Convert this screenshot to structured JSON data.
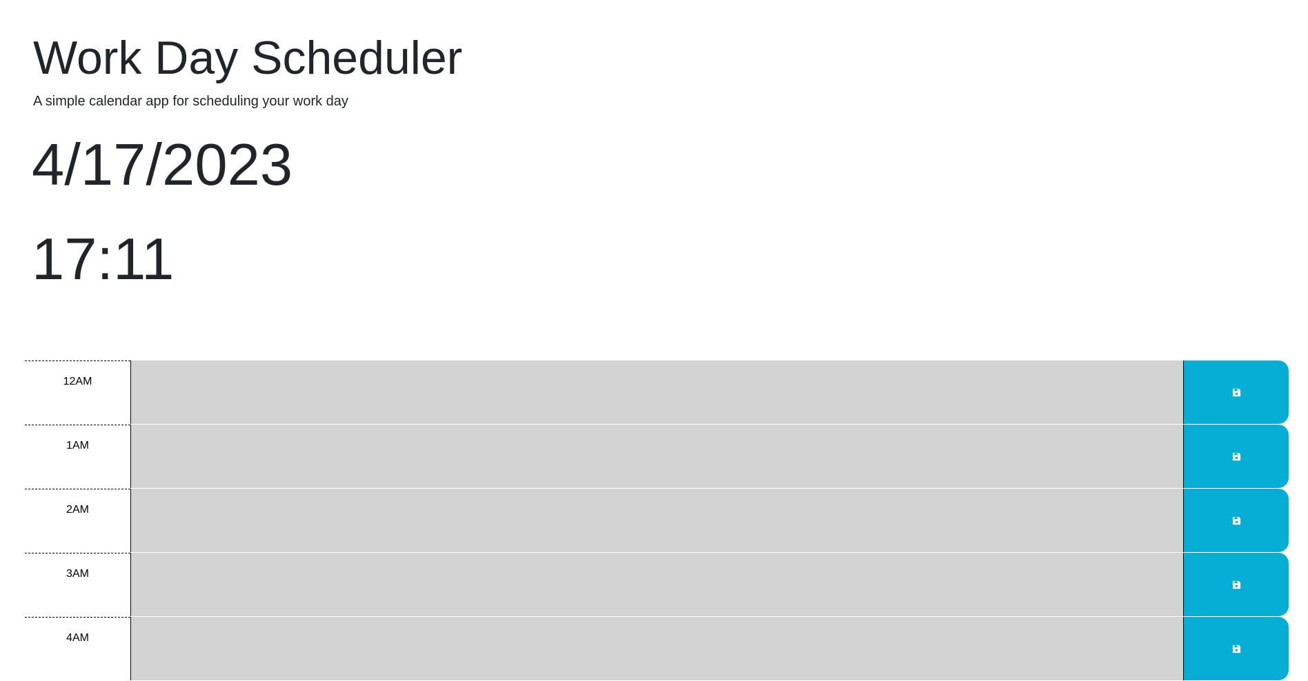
{
  "header": {
    "title": "Work Day Scheduler",
    "subtitle": "A simple calendar app for scheduling your work day",
    "date": "4/17/2023",
    "time": "17:11"
  },
  "colors": {
    "past_block": "#d3d3d3",
    "save_button": "#06aed5",
    "save_icon": "#ffffff"
  },
  "time_blocks": [
    {
      "hour": "12AM",
      "text": "",
      "save_icon": "save-icon"
    },
    {
      "hour": "1AM",
      "text": "",
      "save_icon": "save-icon"
    },
    {
      "hour": "2AM",
      "text": "",
      "save_icon": "save-icon"
    },
    {
      "hour": "3AM",
      "text": "",
      "save_icon": "save-icon"
    },
    {
      "hour": "4AM",
      "text": "",
      "save_icon": "save-icon"
    }
  ]
}
